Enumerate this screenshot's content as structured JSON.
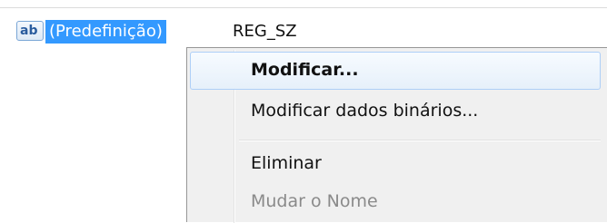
{
  "registry_value": {
    "icon": "string-value-icon",
    "icon_text": "ab",
    "name": "(Predefinição)",
    "type": "REG_SZ"
  },
  "context_menu": {
    "items": [
      {
        "label": "Modificar...",
        "state": "hover"
      },
      {
        "label": "Modificar dados binários...",
        "state": "enabled"
      },
      {
        "label": "Eliminar",
        "state": "enabled"
      },
      {
        "label": "Mudar o Nome",
        "state": "disabled"
      }
    ]
  },
  "colors": {
    "selection": "#3399ff",
    "menu_background": "#f0f0f0",
    "hover_border": "#aecff7",
    "disabled_text": "#8a8a8a"
  }
}
